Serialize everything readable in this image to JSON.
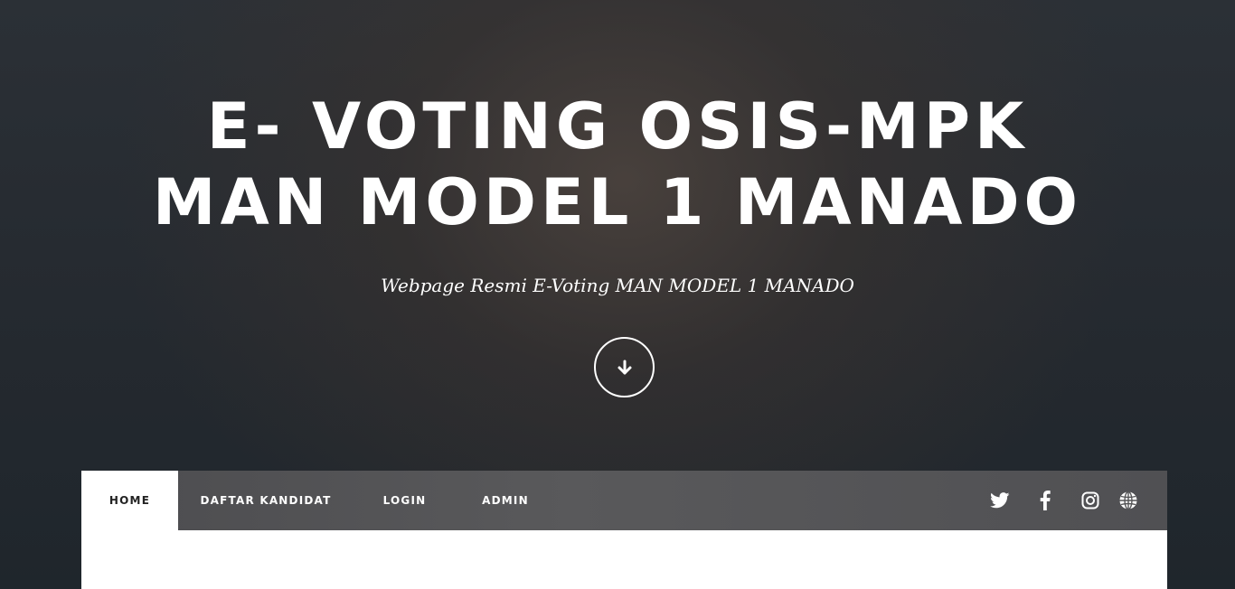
{
  "hero": {
    "title_line1": "E- VOTING OSIS-MPK",
    "title_line2": "MAN MODEL 1 MANADO",
    "subtitle": "Webpage Resmi E-Voting MAN MODEL 1 MANADO",
    "scroll_button_icon": "arrow-down-icon"
  },
  "nav": {
    "items": [
      {
        "label": "HOME",
        "active": true
      },
      {
        "label": "DAFTAR KANDIDAT",
        "active": false
      },
      {
        "label": "LOGIN",
        "active": false
      },
      {
        "label": "ADMIN",
        "active": false
      }
    ],
    "social_icons": [
      "twitter-icon",
      "facebook-icon",
      "instagram-icon",
      "globe-icon"
    ]
  },
  "colors": {
    "text_light": "#ffffff",
    "nav_background": "#555557",
    "active_tab": "#ffffff",
    "active_text": "#222222"
  }
}
